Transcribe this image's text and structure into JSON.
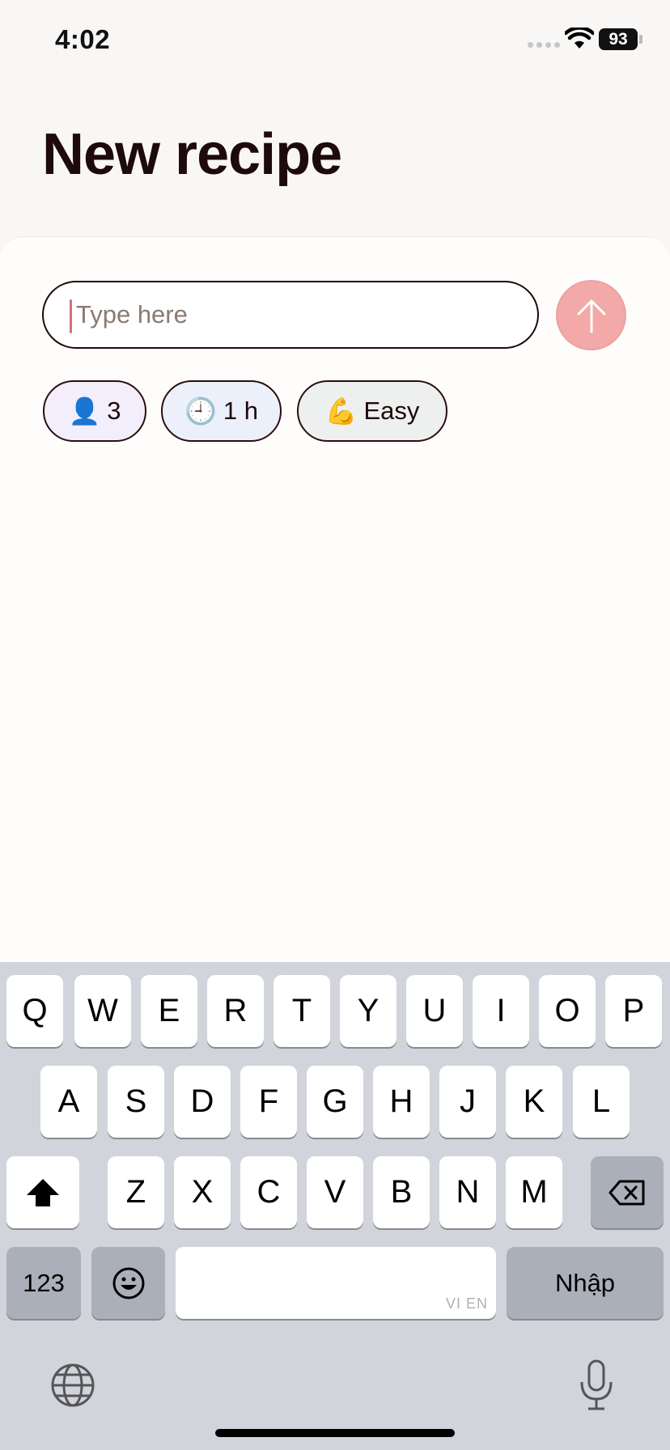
{
  "status_bar": {
    "time": "4:02",
    "battery": "93"
  },
  "page": {
    "title": "New recipe"
  },
  "input": {
    "placeholder": "Type here",
    "value": ""
  },
  "chips": [
    {
      "emoji": "👤",
      "label": "3"
    },
    {
      "emoji": "🕘",
      "label": "1 h"
    },
    {
      "emoji": "💪",
      "label": "Easy"
    }
  ],
  "keyboard": {
    "row1": [
      "Q",
      "W",
      "E",
      "R",
      "T",
      "Y",
      "U",
      "I",
      "O",
      "P"
    ],
    "row2": [
      "A",
      "S",
      "D",
      "F",
      "G",
      "H",
      "J",
      "K",
      "L"
    ],
    "row3": [
      "Z",
      "X",
      "C",
      "V",
      "B",
      "N",
      "M"
    ],
    "numbers_label": "123",
    "return_label": "Nhập",
    "space_hint": "VI EN"
  },
  "colors": {
    "accent": "#f2a9a8",
    "title": "#1e0a0a",
    "keyboard_bg": "#d2d4db"
  }
}
